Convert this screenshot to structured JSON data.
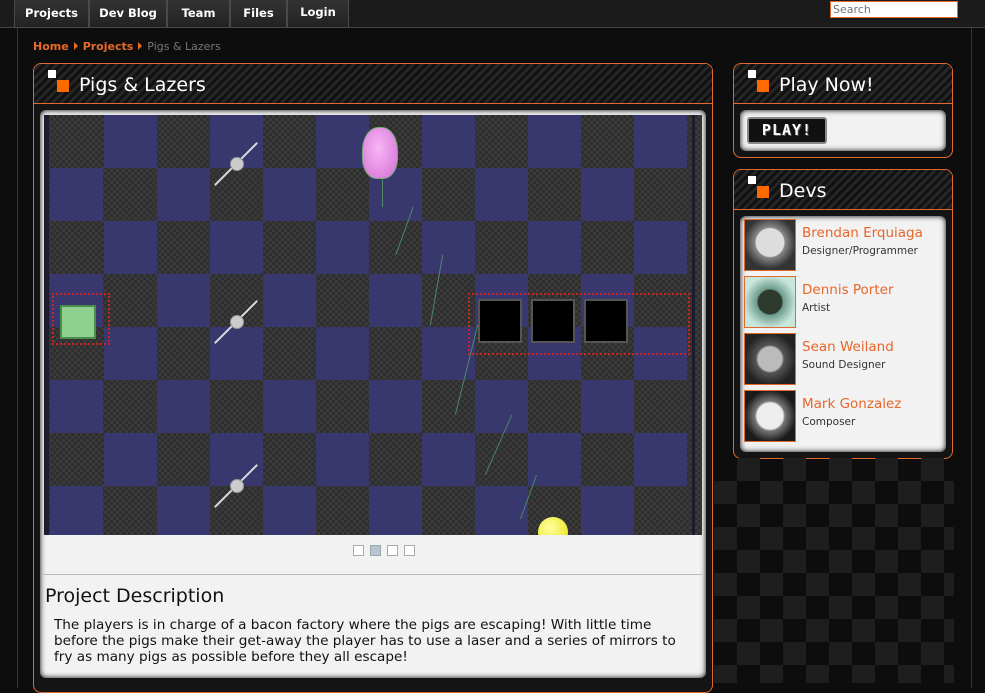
{
  "nav": {
    "items": [
      {
        "label": "Projects"
      },
      {
        "label": "Dev Blog"
      },
      {
        "label": "Team"
      },
      {
        "label": "Files"
      },
      {
        "label": "Login"
      }
    ],
    "search_placeholder": "Search"
  },
  "breadcrumb": {
    "home": "Home",
    "projects": "Projects",
    "current": "Pigs & Lazers"
  },
  "project": {
    "title": "Pigs & Lazers",
    "carousel_pages": 4,
    "carousel_active_page": 2,
    "description_heading": "Project Description",
    "description": "The players is in charge of a bacon factory where the pigs are escaping! With little time before the pigs make their get-away the player has to use a laser and a series of mirrors to fry as many pigs as possible before they all escape!"
  },
  "play": {
    "title": "Play Now!",
    "button_label": "PLAY!"
  },
  "devs": {
    "title": "Devs",
    "members": [
      {
        "name": "Brendan Erquiaga",
        "role": "Designer/Programmer"
      },
      {
        "name": "Dennis Porter",
        "role": "Artist"
      },
      {
        "name": "Sean Weiland",
        "role": "Sound Designer"
      },
      {
        "name": "Mark Gonzalez",
        "role": "Composer"
      }
    ]
  },
  "colors": {
    "accent": "#e06a2c",
    "logo_orange": "#ff6a00",
    "board_blue": "#38386e"
  }
}
